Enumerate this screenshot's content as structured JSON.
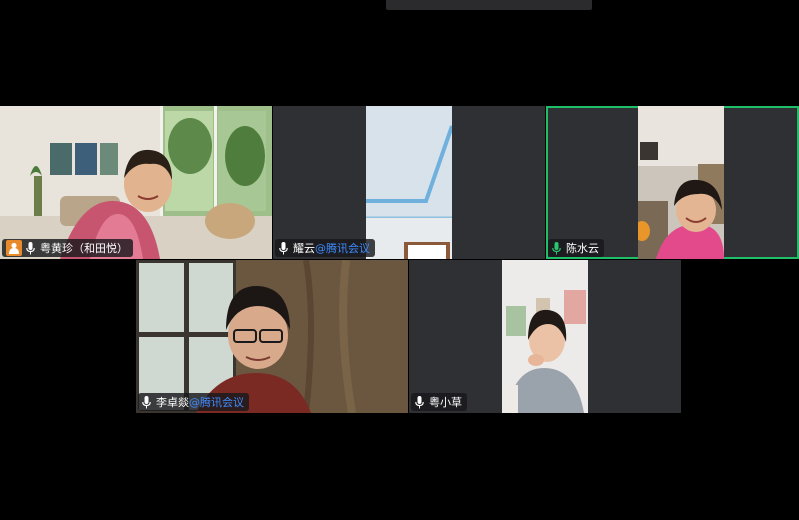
{
  "participants": [
    {
      "name": "粤黄珍（和田悦）",
      "suffix": "",
      "host": true,
      "speaking": false,
      "mic_color": "#ffffff"
    },
    {
      "name": "耀云",
      "suffix": "@腾讯会议",
      "host": false,
      "speaking": false,
      "mic_color": "#ffffff"
    },
    {
      "name": "陈水云",
      "suffix": "",
      "host": false,
      "speaking": true,
      "mic_color": "#28c76f"
    },
    {
      "name": "李卓燚",
      "suffix": "@腾讯会议",
      "host": false,
      "speaking": false,
      "mic_color": "#ffffff"
    },
    {
      "name": "粤小草",
      "suffix": "",
      "host": false,
      "speaking": false,
      "mic_color": "#ffffff"
    }
  ],
  "colors": {
    "background": "#000000",
    "tile": "#2f3033",
    "speaking_border": "#1fbf6a",
    "host_badge": "#e88a2a",
    "suffix_text": "#3f8cff"
  }
}
